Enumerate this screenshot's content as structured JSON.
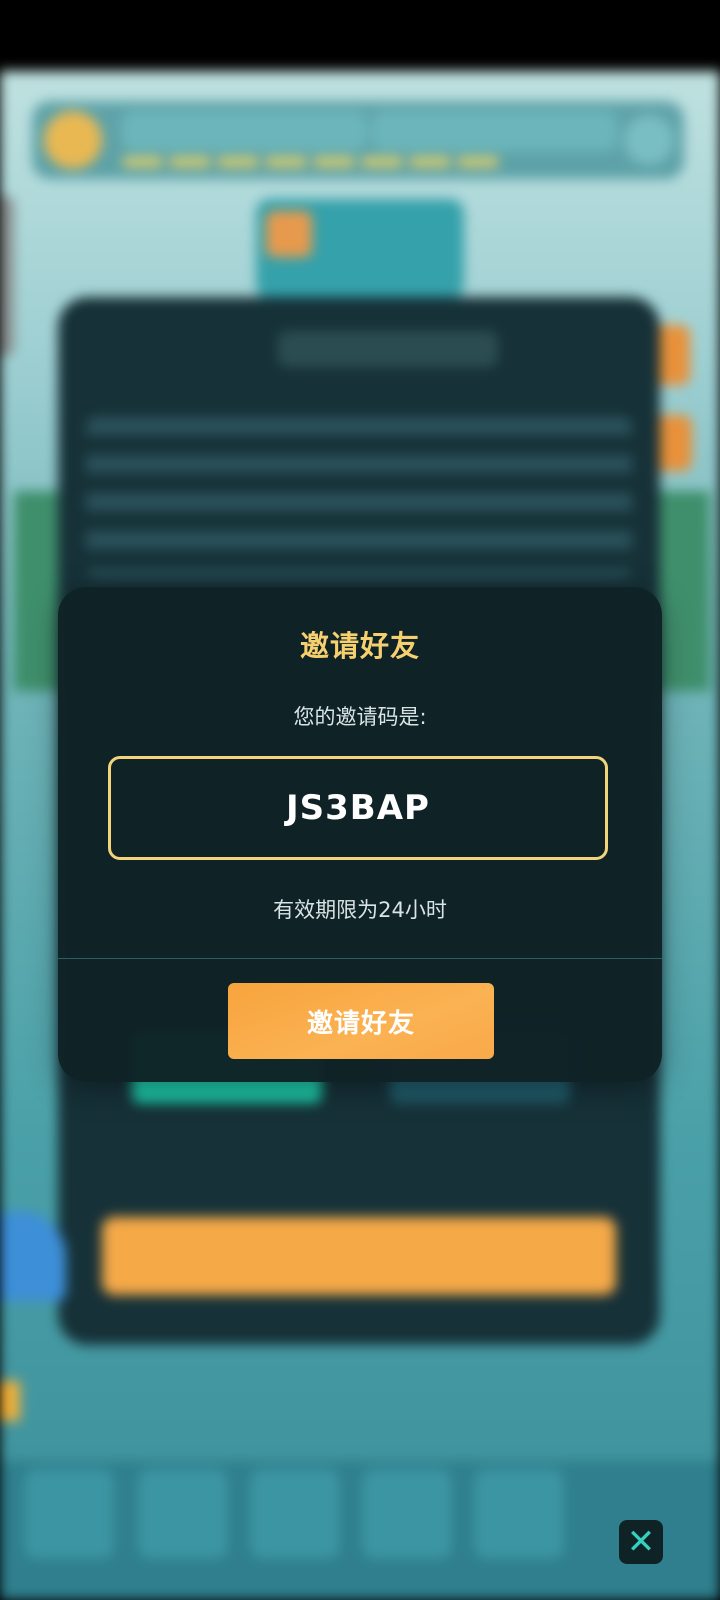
{
  "dialog": {
    "title": "邀请好友",
    "subtitle": "您的邀请码是:",
    "invite_code": "JS3BAP",
    "expiry": "有效期限为24小时",
    "invite_button_label": "邀请好友",
    "accent_color": "#f6cf6f",
    "button_color": "#f7a43d"
  },
  "overlay": {
    "close_icon_glyph": "✕"
  }
}
